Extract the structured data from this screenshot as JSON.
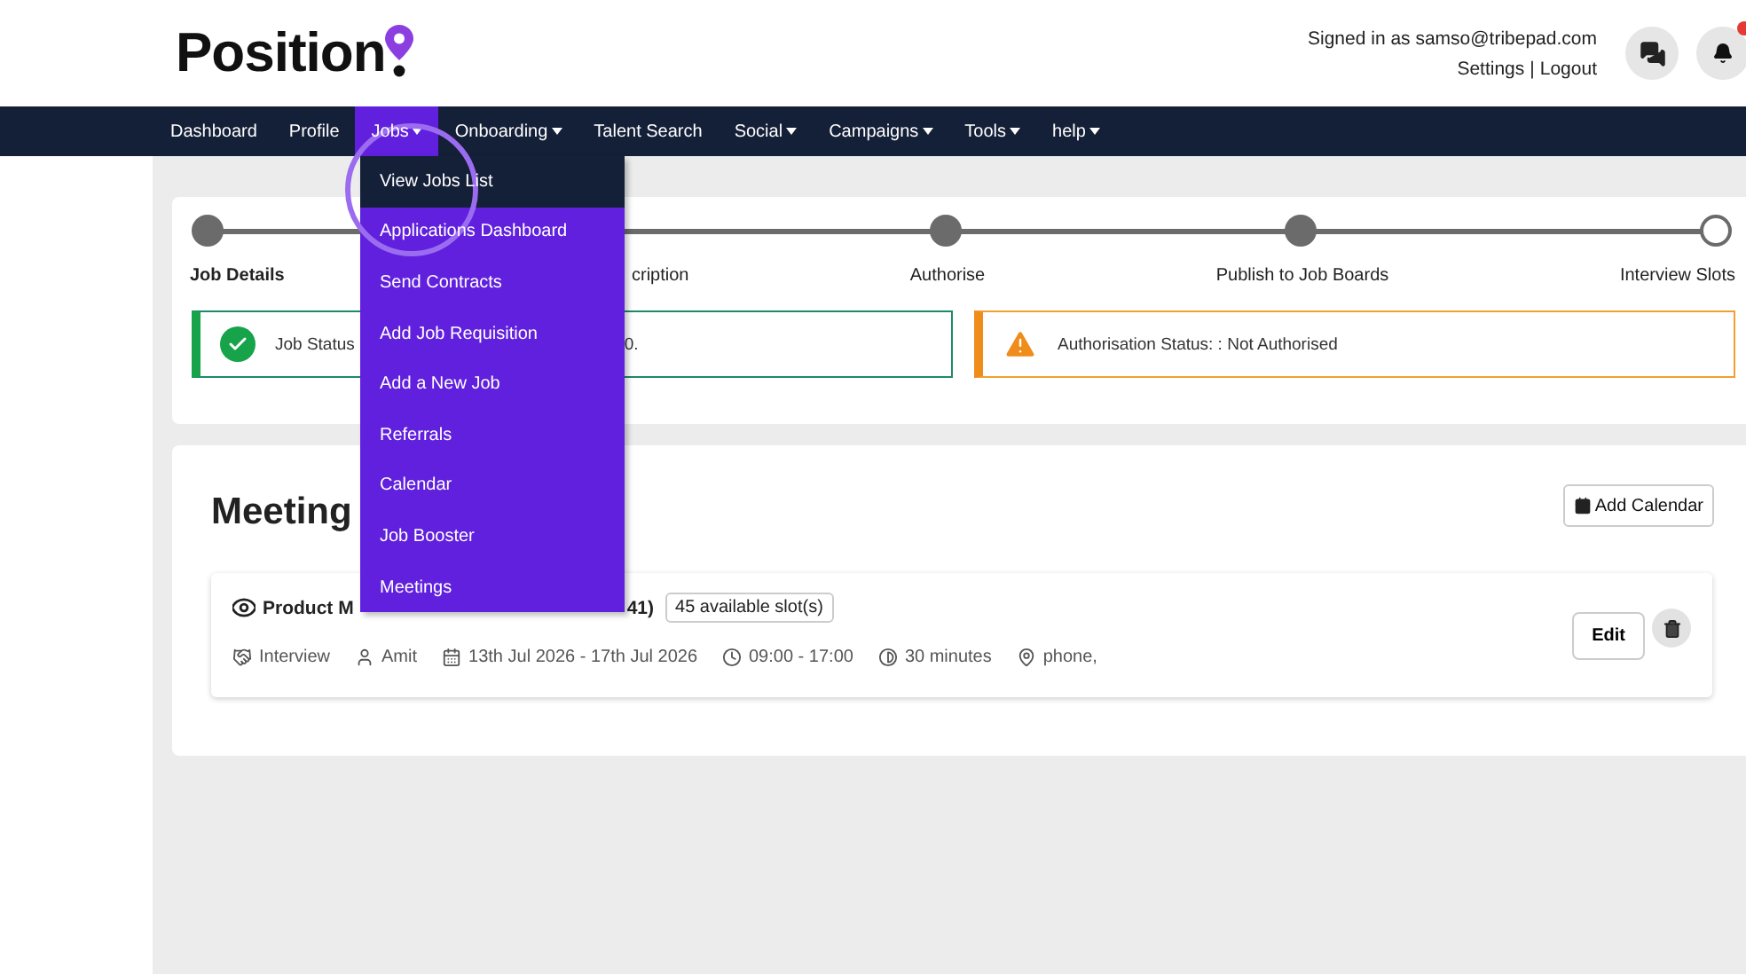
{
  "header": {
    "logo": "Position",
    "signed_in": "Signed in as samso@tribepad.com",
    "links": [
      "Settings",
      "|",
      "Logout"
    ]
  },
  "nav": [
    {
      "label": "Dashboard",
      "menu": false,
      "selected": false
    },
    {
      "label": "Profile",
      "menu": false,
      "selected": false
    },
    {
      "label": "Jobs",
      "menu": true,
      "selected": true
    },
    {
      "label": "Onboarding",
      "menu": true,
      "selected": false
    },
    {
      "label": "Talent Search",
      "menu": false,
      "selected": false
    },
    {
      "label": "Social",
      "menu": true,
      "selected": false
    },
    {
      "label": "Campaigns",
      "menu": true,
      "selected": false
    },
    {
      "label": "Tools",
      "menu": true,
      "selected": false
    },
    {
      "label": "help",
      "menu": true,
      "selected": false
    }
  ],
  "dropdown": [
    {
      "label": "View Jobs List",
      "selected": true
    },
    {
      "label": "Applications Dashboard",
      "selected": false
    },
    {
      "label": "Send Contracts",
      "selected": false
    },
    {
      "label": "Add Job Requisition",
      "selected": false
    },
    {
      "label": "Add a New Job",
      "selected": false
    },
    {
      "label": "Referrals",
      "selected": false
    },
    {
      "label": "Calendar",
      "selected": false
    },
    {
      "label": "Job Booster",
      "selected": false
    },
    {
      "label": "Meetings",
      "selected": false
    }
  ],
  "stepper": [
    {
      "label": "Job Details",
      "current": false
    },
    {
      "label": "cription"
    },
    {
      "label": "Authorise",
      "current": false
    },
    {
      "label": "Publish to Job Boards",
      "current": false
    },
    {
      "label": "Interview Slots",
      "current": true
    }
  ],
  "alerts": [
    {
      "kind": "success",
      "texts": [
        "Job Status",
        "0."
      ]
    },
    {
      "kind": "warning",
      "texts": [
        "Authorisation Status: : Not Authorised"
      ]
    }
  ],
  "meetings": {
    "title": "Meeting",
    "add_button": "Add Calendar",
    "items": [
      {
        "title_parts": [
          "Product M",
          "41)"
        ],
        "slots": "45 available slot(s)",
        "edit": "Edit",
        "meta": [
          {
            "kind": "type",
            "text": "Interview"
          },
          {
            "kind": "person",
            "text": "Amit"
          },
          {
            "kind": "dates",
            "text": "13th Jul 2026 - 17th Jul 2026"
          },
          {
            "kind": "time",
            "text": "09:00 - 17:00"
          },
          {
            "kind": "duration",
            "text": "30 minutes"
          },
          {
            "kind": "location",
            "text": "phone,"
          }
        ]
      }
    ]
  }
}
